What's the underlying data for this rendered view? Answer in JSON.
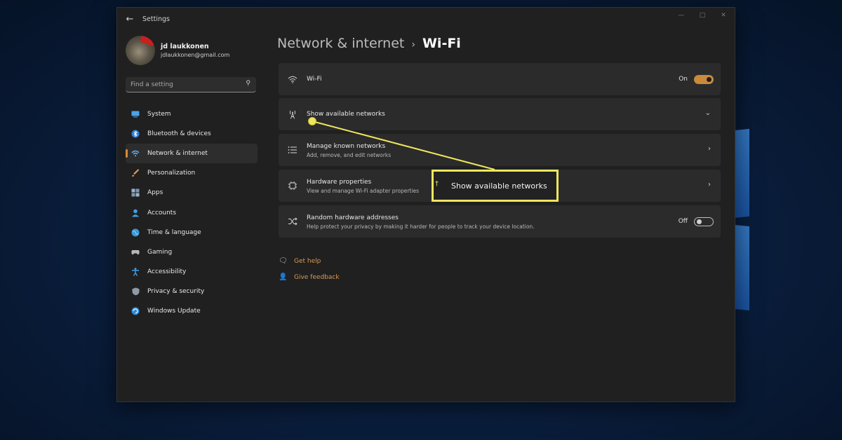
{
  "window": {
    "app_title": "Settings",
    "back_icon": "back-arrow-icon",
    "controls": [
      "minimize",
      "maximize",
      "close"
    ]
  },
  "user": {
    "name": "jd laukkonen",
    "email": "jdlaukkonen@gmail.com"
  },
  "search": {
    "placeholder": "Find a setting",
    "icon": "search-icon"
  },
  "sidebar": {
    "items": [
      {
        "label": "System",
        "icon": "system-icon"
      },
      {
        "label": "Bluetooth & devices",
        "icon": "bluetooth-icon"
      },
      {
        "label": "Network & internet",
        "icon": "network-icon",
        "active": true
      },
      {
        "label": "Personalization",
        "icon": "brush-icon"
      },
      {
        "label": "Apps",
        "icon": "apps-icon"
      },
      {
        "label": "Accounts",
        "icon": "person-icon"
      },
      {
        "label": "Time & language",
        "icon": "globe-icon"
      },
      {
        "label": "Gaming",
        "icon": "controller-icon"
      },
      {
        "label": "Accessibility",
        "icon": "accessibility-icon"
      },
      {
        "label": "Privacy & security",
        "icon": "shield-icon"
      },
      {
        "label": "Windows Update",
        "icon": "update-icon"
      }
    ]
  },
  "header": {
    "parent": "Network & internet",
    "separator": "›",
    "current": "Wi-Fi"
  },
  "settings": {
    "wifi": {
      "label": "Wi-Fi",
      "state": "On",
      "on": true,
      "icon": "wifi-icon"
    },
    "show_networks": {
      "label": "Show available networks",
      "icon": "antenna-icon",
      "chevron": "chevron-down-icon"
    },
    "manage_known": {
      "label": "Manage known networks",
      "desc": "Add, remove, and edit networks",
      "icon": "list-icon",
      "chevron": "chevron-right-icon"
    },
    "hardware": {
      "label": "Hardware properties",
      "desc": "View and manage Wi-Fi adapter properties",
      "icon": "chip-icon",
      "chevron": "chevron-right-icon"
    },
    "random_hw": {
      "label": "Random hardware addresses",
      "desc": "Help protect your privacy by making it harder for people to track your device location.",
      "state": "Off",
      "on": false,
      "icon": "shuffle-icon"
    }
  },
  "links": {
    "help": "Get help",
    "feedback": "Give feedback"
  },
  "callout": {
    "text": "Show available networks",
    "color": "#efe65e"
  },
  "colors": {
    "accent": "#d88a3a",
    "link": "#d99a55",
    "window_bg": "#202020",
    "card_bg": "#2b2b2b"
  }
}
